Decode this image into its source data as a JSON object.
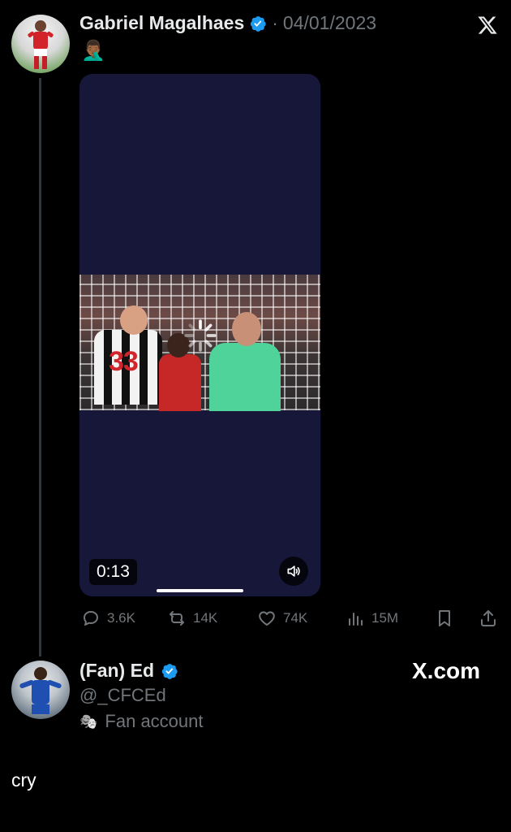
{
  "quoted_tweet": {
    "author_name": "Gabriel Magalhaes",
    "date_separator": "·",
    "date": "04/01/2023",
    "text": "🤦🏾‍♂️",
    "video": {
      "duration": "0:13",
      "player_number": "33"
    },
    "actions": {
      "replies": "3.6K",
      "reposts": "14K",
      "likes": "74K",
      "views": "15M"
    }
  },
  "reply_tweet": {
    "author_name": "(Fan) Ed",
    "handle": "@_CFCEd",
    "label": "Fan account",
    "label_icon": "🎭",
    "brand": "X.com",
    "text": "cry"
  },
  "colors": {
    "background": "#000000",
    "muted_text": "#71767b",
    "verified_blue": "#1d9bf0",
    "media_bg": "#17173a"
  }
}
